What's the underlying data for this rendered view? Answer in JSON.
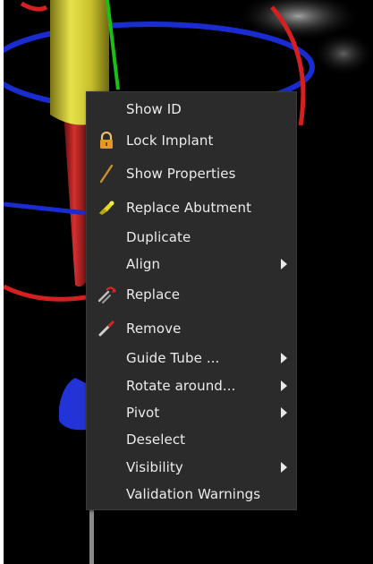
{
  "menu": {
    "items": [
      {
        "label": "Show ID",
        "icon": null,
        "submenu": false
      },
      {
        "label": "Lock Implant",
        "icon": "lock-icon",
        "submenu": false
      },
      {
        "label": "Show Properties",
        "icon": "pencil-icon",
        "submenu": false
      },
      {
        "label": "Replace Abutment",
        "icon": "abutment-icon",
        "submenu": false
      },
      {
        "label": "Duplicate",
        "icon": null,
        "submenu": false
      },
      {
        "label": "Align",
        "icon": null,
        "submenu": true
      },
      {
        "label": "Replace",
        "icon": "replace-icon",
        "submenu": false
      },
      {
        "label": "Remove",
        "icon": "remove-icon",
        "submenu": false
      },
      {
        "label": "Guide Tube ...",
        "icon": null,
        "submenu": true
      },
      {
        "label": "Rotate around...",
        "icon": null,
        "submenu": true
      },
      {
        "label": "Pivot",
        "icon": null,
        "submenu": true
      },
      {
        "label": "Deselect",
        "icon": null,
        "submenu": false
      },
      {
        "label": "Visibility",
        "icon": null,
        "submenu": true
      },
      {
        "label": "Validation Warnings",
        "icon": null,
        "submenu": false
      }
    ]
  },
  "colors": {
    "menu_background": "#2b2b2b",
    "menu_text": "#ececec",
    "ring_red": "#d42020",
    "ring_blue": "#1a2bd0",
    "implant_yellow": "#d8d030",
    "axis_green": "#18c018"
  }
}
